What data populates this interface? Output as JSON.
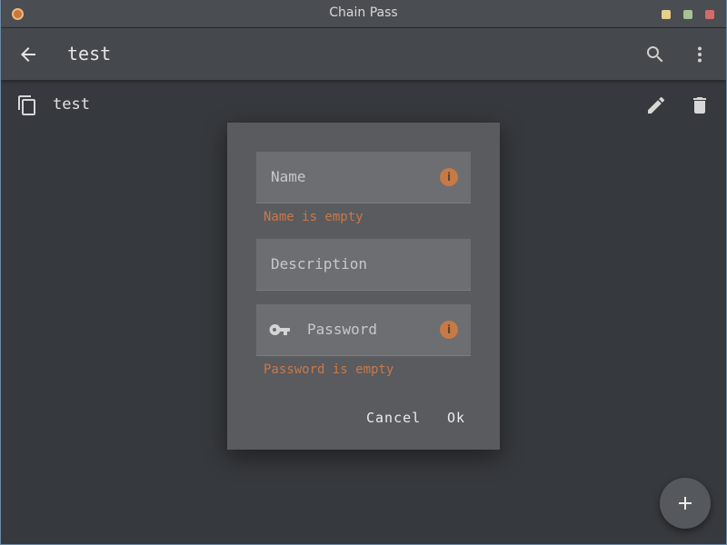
{
  "window": {
    "title": "Chain Pass",
    "controls": {
      "minimize_color": "#e6cf8b",
      "maximize_color": "#a7c394",
      "close_color": "#d46a6a"
    }
  },
  "appbar": {
    "title": "test",
    "icons": [
      "back-arrow-icon",
      "search-icon",
      "more-vert-icon"
    ]
  },
  "list": {
    "items": [
      {
        "label": "test",
        "icons": [
          "copy-icon",
          "edit-icon",
          "delete-icon"
        ]
      }
    ]
  },
  "dialog": {
    "name_field": {
      "placeholder": "Name",
      "error": "Name is empty"
    },
    "description_field": {
      "placeholder": "Description"
    },
    "password_field": {
      "placeholder": "Password",
      "error": "Password is empty"
    },
    "info_glyph": "i",
    "cancel_label": "Cancel",
    "ok_label": "Ok"
  },
  "fab": {
    "icon": "plus-icon"
  },
  "colors": {
    "background": "#36393d",
    "appbar": "#45484c",
    "dialog": "#595b5f",
    "field": "#6c6e71",
    "error": "#c8784a"
  }
}
